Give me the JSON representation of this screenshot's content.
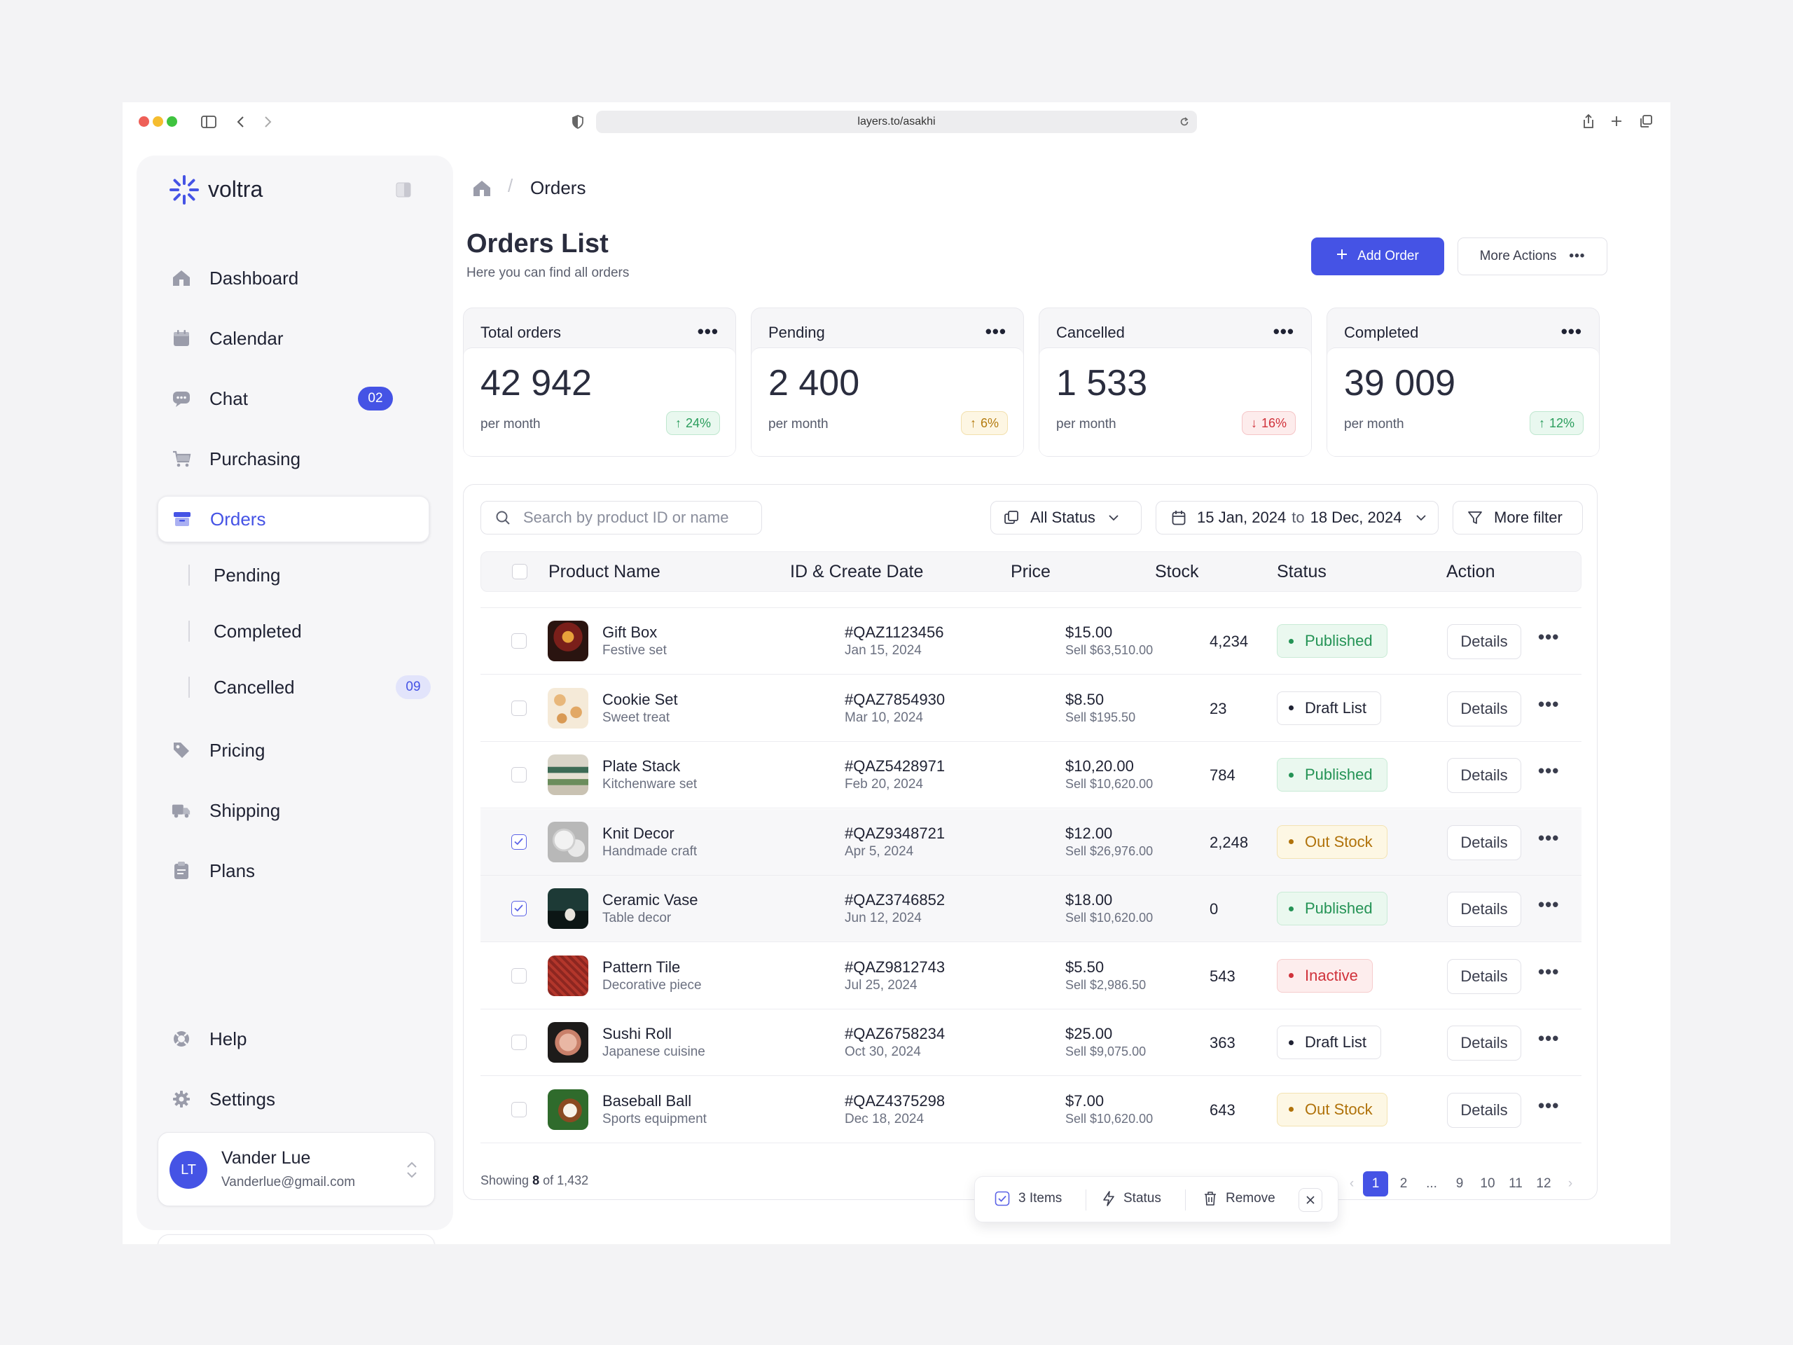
{
  "browser": {
    "url": "layers.to/asakhi"
  },
  "brand": {
    "name": "voltra",
    "accent": "#4553e5"
  },
  "sidebar": {
    "items": [
      {
        "label": "Dashboard",
        "icon": "home-icon"
      },
      {
        "label": "Calendar",
        "icon": "calendar-icon"
      },
      {
        "label": "Chat",
        "icon": "chat-icon",
        "badge": "02"
      },
      {
        "label": "Purchasing",
        "icon": "cart-icon"
      },
      {
        "label": "Orders",
        "icon": "orders-icon",
        "active": true
      },
      {
        "label": "Pricing",
        "icon": "tag-icon"
      },
      {
        "label": "Shipping",
        "icon": "truck-icon"
      },
      {
        "label": "Plans",
        "icon": "clipboard-icon"
      }
    ],
    "subitems": [
      {
        "label": "Pending"
      },
      {
        "label": "Completed"
      },
      {
        "label": "Cancelled",
        "badge": "09"
      }
    ],
    "help": "Help",
    "settings": "Settings",
    "user": {
      "initials": "LT",
      "name": "Vander Lue",
      "email": "Vanderlue@gmail.com"
    }
  },
  "breadcrumb": {
    "current": "Orders"
  },
  "page": {
    "title": "Orders List",
    "subtitle": "Here you can find all orders",
    "add_order": "Add Order",
    "more_actions": "More Actions"
  },
  "stats": [
    {
      "label": "Total orders",
      "value": "42 942",
      "period": "per month",
      "change": "24%",
      "trend": "up"
    },
    {
      "label": "Pending",
      "value": "2 400",
      "period": "per month",
      "change": "6%",
      "trend": "up"
    },
    {
      "label": "Cancelled",
      "value": "1 533",
      "period": "per month",
      "change": "16%",
      "trend": "down"
    },
    {
      "label": "Completed",
      "value": "39 009",
      "period": "per month",
      "change": "12%",
      "trend": "up"
    }
  ],
  "filters": {
    "search_placeholder": "Search by product ID or name",
    "status": "All Status",
    "date_from": "15 Jan, 2024",
    "date_to_word": "to",
    "date_to": "18 Dec, 2024",
    "more_filter": "More filter"
  },
  "table": {
    "columns": [
      "Product Name",
      "ID & Create Date",
      "Price",
      "Stock",
      "Status",
      "Action"
    ],
    "action_label": "Details",
    "rows": [
      {
        "name": "Gift Box",
        "desc": "Festive set",
        "id": "#QAZ1123456",
        "date": "Jan 15, 2024",
        "price": "$15.00",
        "sell": "Sell $63,510.00",
        "stock": "4,234",
        "status": "Published",
        "kind": "pub",
        "checked": false,
        "thumb": "gift-box-thumbnail"
      },
      {
        "name": "Cookie Set",
        "desc": "Sweet treat",
        "id": "#QAZ7854930",
        "date": "Mar 10, 2024",
        "price": "$8.50",
        "sell": "Sell $195.50",
        "stock": "23",
        "status": "Draft List",
        "kind": "draft",
        "checked": false,
        "thumb": "cookie-set-thumbnail"
      },
      {
        "name": "Plate Stack",
        "desc": "Kitchenware set",
        "id": "#QAZ5428971",
        "date": "Feb 20, 2024",
        "price": "$10,20.00",
        "sell": "Sell $10,620.00",
        "stock": "784",
        "status": "Published",
        "kind": "pub",
        "checked": false,
        "thumb": "plate-stack-thumbnail"
      },
      {
        "name": "Knit Decor",
        "desc": "Handmade craft",
        "id": "#QAZ9348721",
        "date": "Apr 5, 2024",
        "price": "$12.00",
        "sell": "Sell $26,976.00",
        "stock": "2,248",
        "status": "Out Stock",
        "kind": "out",
        "checked": true,
        "thumb": "knit-decor-thumbnail"
      },
      {
        "name": "Ceramic Vase",
        "desc": "Table decor",
        "id": "#QAZ3746852",
        "date": "Jun 12, 2024",
        "price": "$18.00",
        "sell": "Sell $10,620.00",
        "stock": "0",
        "status": "Published",
        "kind": "pub",
        "checked": true,
        "thumb": "ceramic-vase-thumbnail"
      },
      {
        "name": "Pattern Tile",
        "desc": "Decorative piece",
        "id": "#QAZ9812743",
        "date": "Jul 25, 2024",
        "price": "$5.50",
        "sell": "Sell $2,986.50",
        "stock": "543",
        "status": "Inactive",
        "kind": "in",
        "checked": false,
        "thumb": "pattern-tile-thumbnail"
      },
      {
        "name": "Sushi Roll",
        "desc": "Japanese cuisine",
        "id": "#QAZ6758234",
        "date": "Oct 30, 2024",
        "price": "$25.00",
        "sell": "Sell $9,075.00",
        "stock": "363",
        "status": "Draft List",
        "kind": "draft",
        "checked": false,
        "thumb": "sushi-roll-thumbnail"
      },
      {
        "name": "Baseball Ball",
        "desc": "Sports equipment",
        "id": "#QAZ4375298",
        "date": "Dec 18, 2024",
        "price": "$7.00",
        "sell": "Sell $10,620.00",
        "stock": "643",
        "status": "Out Stock",
        "kind": "out",
        "checked": false,
        "thumb": "baseball-thumbnail"
      }
    ]
  },
  "footer": {
    "showing_prefix": "Showing",
    "showing_count": "8",
    "showing_suffix": "of 1,432"
  },
  "pagination": [
    "1",
    "2",
    "...",
    "9",
    "10",
    "11",
    "12"
  ],
  "bulk": {
    "items": "3 Items",
    "status": "Status",
    "remove": "Remove"
  },
  "colors": {
    "published": "#249355",
    "out_stock": "#b0720a",
    "inactive": "#d0313a",
    "primary": "#4553e5"
  }
}
